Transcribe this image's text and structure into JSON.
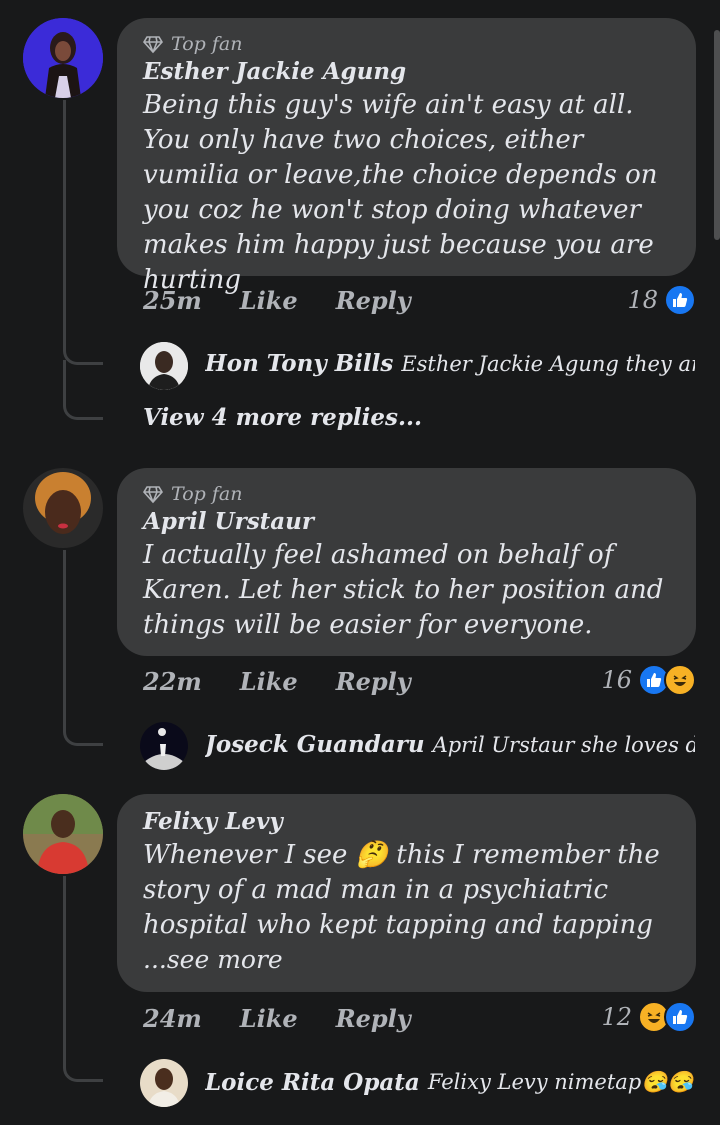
{
  "comments": [
    {
      "badge": "Top fan",
      "author": "Esther Jackie Agung",
      "text": "Being this guy's wife ain't easy at all. You only have two choices, either  vumilia or leave,the choice depends on you coz he won't stop doing whatever makes him happy  just because you are hurting",
      "time": "25m",
      "like_label": "Like",
      "reply_label": "Reply",
      "reaction_count": "18",
      "reactions": [
        "like"
      ],
      "reply": {
        "author": "Hon Tony Bills",
        "text": "Esther Jackie Agung they are m..."
      },
      "view_more": "View 4 more replies..."
    },
    {
      "badge": "Top fan",
      "author": "April Urstaur",
      "text": "I actually feel ashamed on behalf of Karen. Let her stick to her position and things will be easier for everyone.",
      "time": "22m",
      "like_label": "Like",
      "reply_label": "Reply",
      "reaction_count": "16",
      "reactions": [
        "like",
        "haha"
      ],
      "reply": {
        "author": "Joseck Guandaru",
        "text": "April Urstaur she loves dram..."
      }
    },
    {
      "author": "Felixy Levy",
      "text_before_emoji": "Whenever I see ",
      "emoji": "🤔",
      "text_after_emoji": " this I remember the story of a mad man in a psychiatric hospital who kept tapping and tapping",
      "see_more": "...see more",
      "time": "24m",
      "like_label": "Like",
      "reply_label": "Reply",
      "reaction_count": "12",
      "reactions": [
        "haha",
        "like"
      ],
      "reply": {
        "author": "Loice Rita Opata",
        "text": "Felixy Levy nimetap😪😪😪..."
      }
    }
  ],
  "colors": {
    "background": "#18191a",
    "bubble": "#3a3b3c",
    "like_blue": "#1877f2",
    "haha_yellow": "#f7b125"
  }
}
